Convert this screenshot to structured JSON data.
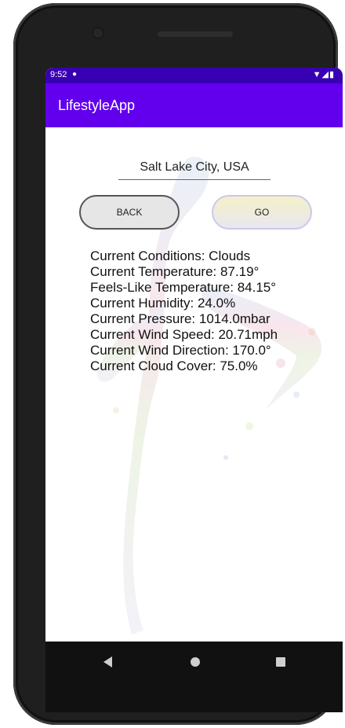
{
  "status_bar": {
    "time": "9:52",
    "notification_icon": "settings-notification-icon",
    "icons": [
      "wifi-icon",
      "signal-icon",
      "battery-icon"
    ]
  },
  "app_bar": {
    "title": "LifestyleApp",
    "color": "#6200ee",
    "status_color": "#3700b3"
  },
  "location": {
    "value": "Salt Lake City, USA"
  },
  "buttons": {
    "back_label": "BACK",
    "go_label": "GO"
  },
  "weather": {
    "conditions": "Current Conditions: Clouds",
    "temperature": "Current Temperature: 87.19°",
    "feels_like": "Feels-Like Temperature: 84.15°",
    "humidity": "Current Humidity: 24.0%",
    "pressure": "Current Pressure: 1014.0mbar",
    "wind_speed": "Current Wind Speed: 20.71mph",
    "wind_direction": "Current Wind Direction: 170.0°",
    "cloud_cover": "Current Cloud Cover: 75.0%"
  },
  "nav_bar": {
    "icons": [
      "back-triangle-icon",
      "home-circle-icon",
      "recents-square-icon"
    ]
  }
}
